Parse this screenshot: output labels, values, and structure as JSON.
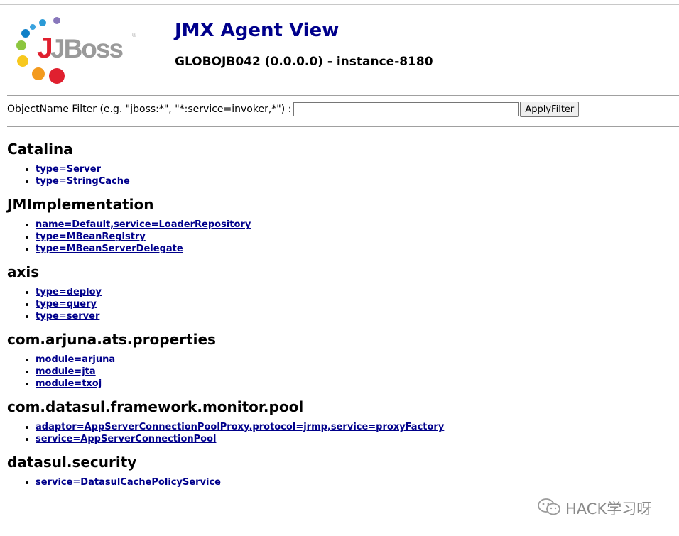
{
  "header": {
    "title": "JMX Agent View",
    "subtitle": "GLOBOJB042 (0.0.0.0) - instance-8180"
  },
  "logo": {
    "text": "JBoss"
  },
  "filter": {
    "label": "ObjectName Filter (e.g. \"jboss:*\", \"*:service=invoker,*\") :",
    "value": "",
    "button_label": "ApplyFilter"
  },
  "domains": [
    {
      "name": "Catalina",
      "mbeans": [
        "type=Server",
        "type=StringCache"
      ]
    },
    {
      "name": "JMImplementation",
      "mbeans": [
        "name=Default,service=LoaderRepository",
        "type=MBeanRegistry",
        "type=MBeanServerDelegate"
      ]
    },
    {
      "name": "axis",
      "mbeans": [
        "type=deploy",
        "type=query",
        "type=server"
      ]
    },
    {
      "name": "com.arjuna.ats.properties",
      "mbeans": [
        "module=arjuna",
        "module=jta",
        "module=txoj"
      ]
    },
    {
      "name": "com.datasul.framework.monitor.pool",
      "mbeans": [
        "adaptor=AppServerConnectionPoolProxy,protocol=jrmp,service=proxyFactory",
        "service=AppServerConnectionPool"
      ]
    },
    {
      "name": "datasul.security",
      "mbeans": [
        "service=DatasulCachePolicyService"
      ]
    }
  ],
  "watermark": {
    "text": "HACK学习呀",
    "icon": "wechat-icon"
  },
  "colors": {
    "link": "#00008b",
    "title": "#00008b"
  }
}
